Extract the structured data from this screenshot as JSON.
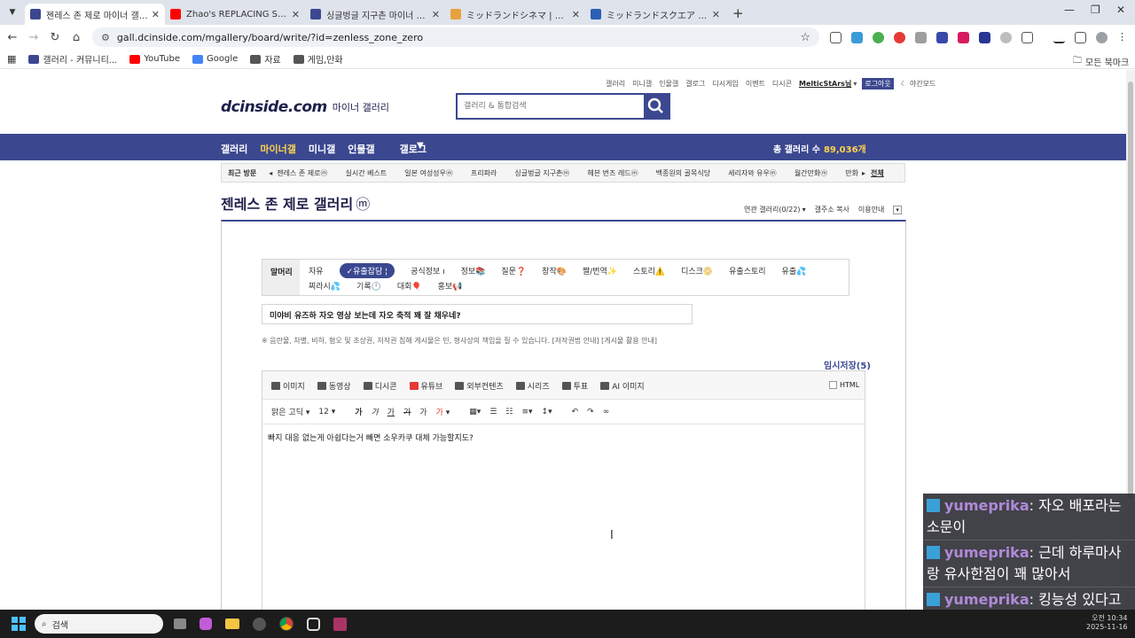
{
  "tabs": [
    {
      "title": "젠레스 존 제로 마이너 갤러리",
      "active": true,
      "icon_color": "#3b4890"
    },
    {
      "title": "Zhao's REPLACING Soukaku |",
      "active": false,
      "icon_color": "#ff0000"
    },
    {
      "title": "싱글벙글 지구촌 마이너 갤러리",
      "active": false,
      "icon_color": "#3b4890"
    },
    {
      "title": "ミッドランドシネマ | 上映スケ",
      "active": false,
      "icon_color": "#e6a23c"
    },
    {
      "title": "ミッドランドスクエア シネマ",
      "active": false,
      "icon_color": "#2d5fb4"
    }
  ],
  "address_bar": {
    "url": "gall.dcinside.com/mgallery/board/write/?id=zenless_zone_zero"
  },
  "bookmarks": [
    {
      "label": "갤러리 - 커뮤니티...",
      "icon": "dc-icon",
      "color": "#3b4890"
    },
    {
      "label": "YouTube",
      "icon": "youtube-icon",
      "color": "#ff0000"
    },
    {
      "label": "Google",
      "icon": "google-icon",
      "color": "#4285f4"
    },
    {
      "label": "자료",
      "icon": "folder-icon",
      "color": "#555"
    },
    {
      "label": "게임,만화",
      "icon": "folder-icon",
      "color": "#555"
    }
  ],
  "bookmarks_right": "모든 북마크",
  "site": {
    "util_links": [
      "갤러리",
      "미니갤",
      "인물갤",
      "갤로그",
      "디시게임",
      "이벤트",
      "디시콘"
    ],
    "username": "MelticStArs님",
    "logout": "로그아웃",
    "night_mode": "야간모드",
    "logo": "dcinside.com",
    "logo_sub": "마이너 갤러리",
    "search_placeholder": "갤러리 & 통합검색",
    "gnb": [
      "갤러리",
      "마이너갤",
      "미니갤",
      "인물갤",
      "갤로그"
    ],
    "total_galleries_label": "총 갤러리 수",
    "total_galleries_value": "89,036개",
    "recent_label": "최근 방문",
    "recent_items": [
      "젠레스 존 제로ⓜ",
      "실시간 베스트",
      "일본 여성성우ⓜ",
      "프리파라",
      "싱글벙글 지구촌ⓜ",
      "헤븐 번즈 레드ⓜ",
      "백종원의 골목식당",
      "세리자와 유우ⓜ",
      "월간만화ⓜ",
      "만화"
    ],
    "recent_all": "전체",
    "gallery_title": "젠레스 존 제로 갤러리",
    "gallery_badge": "ⓜ",
    "linked_gallery": "연관 갤러리(0/22)",
    "copy_addr": "갤주소 복사",
    "usage_guide": "이용안내"
  },
  "write": {
    "category_label": "말머리",
    "categories": [
      "자유",
      "✓유출잡담 ¦",
      "공식정보 ı",
      "정보📚",
      "질문❓",
      "창작🎨",
      "짤/번역✨",
      "스토리⚠️",
      "디스크📀",
      "유출스토리",
      "유출💦",
      "찌라시💦",
      "기록🕛",
      "대회🎈",
      "홍보📢"
    ],
    "selected_category": "✓유출잡담 ¦",
    "title_value": "미야비 유즈하 자오 영상 보는데 자오 축적 꽤 잘 채우네?",
    "notice": "※ 음란물, 차별, 비하, 혐오 및 초상권, 저작권 침해 게시물은 민, 형사상의 책임을 질 수 있습니다. [저작권법 안내] [게시물 활용 안내]",
    "temp_save": "임시저장(5)",
    "toolbar": [
      {
        "label": "이미지",
        "icon": "image-icon"
      },
      {
        "label": "동영상",
        "icon": "video-icon"
      },
      {
        "label": "디시콘",
        "icon": "dccon-icon"
      },
      {
        "label": "유튜브",
        "icon": "youtube-icon"
      },
      {
        "label": "외부컨텐츠",
        "icon": "external-icon"
      },
      {
        "label": "시리즈",
        "icon": "series-icon"
      },
      {
        "label": "투표",
        "icon": "vote-icon"
      },
      {
        "label": "AI 이미지",
        "icon": "ai-image-icon"
      }
    ],
    "html_label": "HTML",
    "font_name": "맑은 고딕",
    "font_size": "12",
    "format_buttons": [
      "가",
      "가",
      "가",
      "가",
      "가",
      "가"
    ],
    "body_text": "빠지 대응 없는게 아쉽다는거 빼면 소우카쿠 대체 가능할지도?"
  },
  "chat": [
    {
      "user": "yumeprika",
      "message": ": 자오 배포라는 소문이"
    },
    {
      "user": "yumeprika",
      "message": ": 근데 하루마사랑 유사한점이 꽤 많아서"
    },
    {
      "user": "yumeprika",
      "message": ": 킹능성 있다고 함"
    }
  ],
  "taskbar": {
    "search_placeholder": "검색",
    "time": "오전 10:34",
    "date": "2025-11-16"
  }
}
